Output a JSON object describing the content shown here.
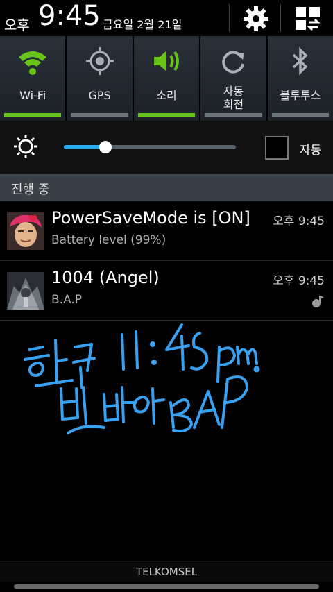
{
  "status_bar": {
    "ampm": "오후",
    "time": "9:45",
    "date": "금요일 2월 21일"
  },
  "quick_toggles": [
    {
      "label": "Wi-Fi",
      "icon": "wifi-icon",
      "on": true
    },
    {
      "label": "GPS",
      "icon": "gps-icon",
      "on": false
    },
    {
      "label": "소리",
      "icon": "sound-icon",
      "on": true
    },
    {
      "label_line1": "자동",
      "label_line2": "회전",
      "icon": "rotate-icon",
      "on": false
    },
    {
      "label": "블루투스",
      "icon": "bluetooth-icon",
      "on": false
    }
  ],
  "brightness": {
    "level": 0.24,
    "auto_label": "자동",
    "auto_checked": false
  },
  "section_header": "진행 중",
  "notifications": [
    {
      "title": "PowerSaveMode is [ON]",
      "subtitle": "Battery level (99%)",
      "time": "오후 9:45"
    },
    {
      "title": "1004 (Angel)",
      "subtitle": "B.A.P",
      "time": "오후 9:45"
    }
  ],
  "carrier": "TELKOMSEL",
  "colors": {
    "accent_green": "#69c41a",
    "accent_blue": "#2ea8e8",
    "ink_blue": "#3aa0f0"
  }
}
